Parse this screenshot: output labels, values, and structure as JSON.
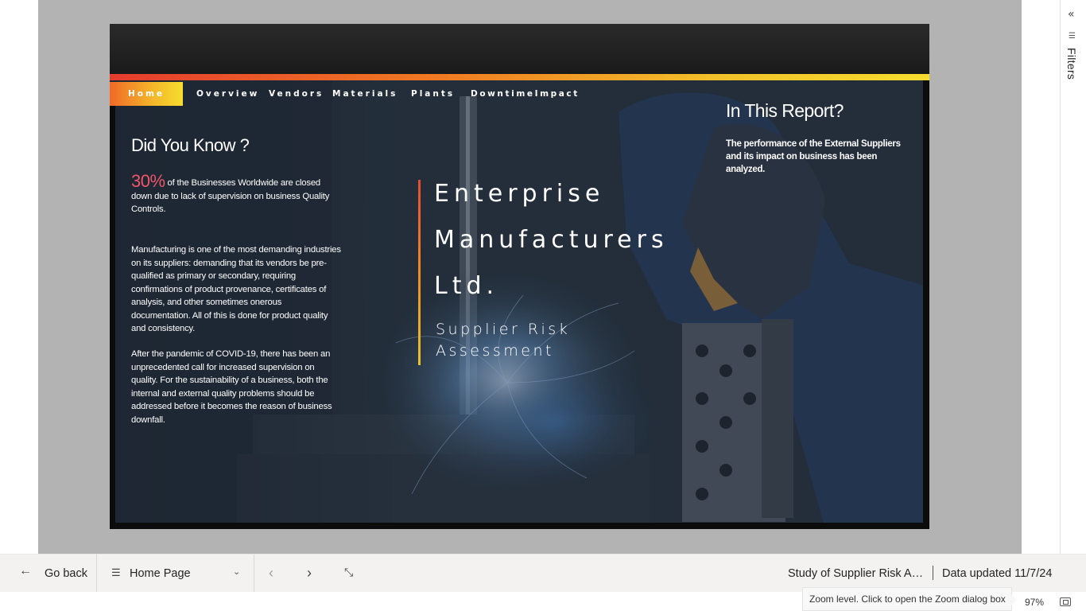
{
  "report": {
    "nav": {
      "tabs": [
        "Home",
        "Overview",
        "Vendors",
        "Materials",
        "Plants",
        "DowntimeImpact"
      ],
      "active": "Home"
    },
    "did_you_know": {
      "heading": "Did You Know ?",
      "stat_value": "30%",
      "stat_text": " of the Businesses Worldwide  are closed down due to lack of supervision on business Quality Controls.",
      "paragraph_1": "Manufacturing is one of the most demanding industries on its suppliers: demanding that its vendors be pre-qualified as primary or secondary, requiring confirmations of product provenance, certificates of analysis, and other sometimes onerous documentation. All of this is done for  product quality and consistency.",
      "paragraph_2": "After the pandemic of COVID-19, there has been an unprecedented call for increased supervision on quality. For the sustainability of a business, both the internal and external quality problems should be addressed before it becomes the reason of business downfall."
    },
    "title": {
      "line_1": "Enterprise",
      "line_2": "Manufacturers",
      "line_3": "Ltd.",
      "subtitle": "Supplier Risk Assessment"
    },
    "in_this_report": {
      "heading": "In This Report?",
      "text": "The performance of the External Suppliers and its impact on business has been analyzed."
    },
    "colors": {
      "accent_red": "#f0556a",
      "gradient_start": "#e53c2e",
      "gradient_end": "#f6dc2e",
      "page_bg": "#1e2733"
    }
  },
  "filters_pane": {
    "label": "Filters",
    "collapse_icon": "double-chevron-left-icon",
    "filter_icon": "filter-lines-icon"
  },
  "bottom_bar": {
    "go_back": "Go back",
    "page_selector": "Home Page",
    "report_name": "Study of Supplier Risk Ass...",
    "data_updated": "Data updated 11/7/24"
  },
  "status_bar": {
    "zoom_tooltip": "Zoom level. Click to open the Zoom dialog box",
    "zoom_level": "97%"
  }
}
